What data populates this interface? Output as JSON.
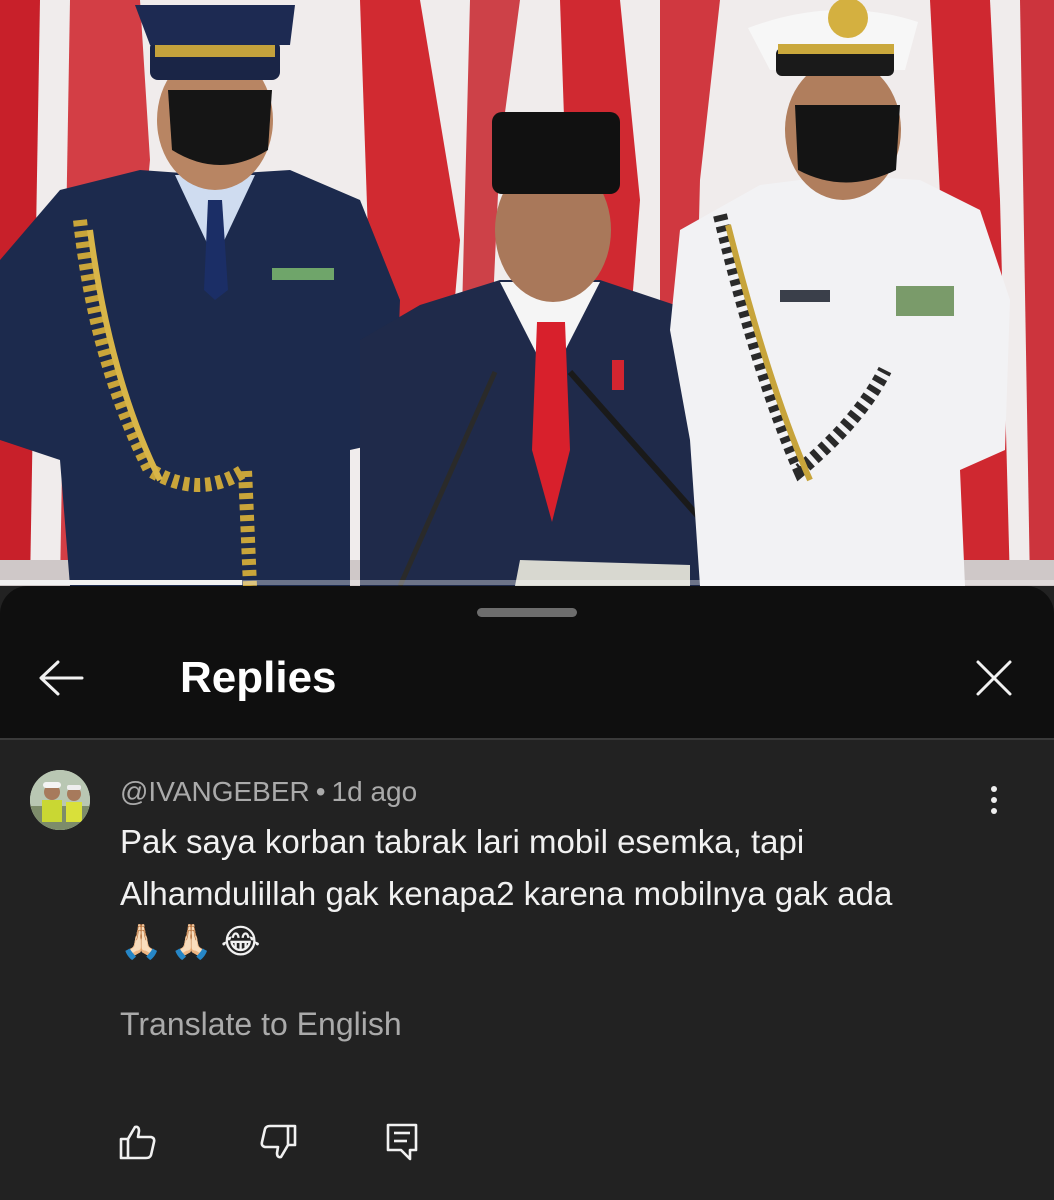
{
  "video": {
    "progress_fraction": 0.23
  },
  "sheet": {
    "title": "Replies",
    "icons": {
      "back": "arrow-left-icon",
      "close": "close-icon"
    }
  },
  "comment": {
    "author": "@IVANGEBER",
    "separator": "•",
    "time": "1d ago",
    "text": "Pak saya korban tabrak lari mobil esemka, tapi Alhamdulillah gak kenapa2 karena mobilnya gak ada",
    "emojis": [
      "🙏🏻",
      "🙏🏻",
      "😂"
    ],
    "translate_label": "Translate to English",
    "actions": {
      "like": "thumbs-up-icon",
      "dislike": "thumbs-down-icon",
      "reply": "reply-comment-icon",
      "more": "more-vertical-icon"
    }
  },
  "colors": {
    "header_bg": "#0f0f0f",
    "sheet_bg": "#222222",
    "secondary_text": "#aaaaaa"
  }
}
